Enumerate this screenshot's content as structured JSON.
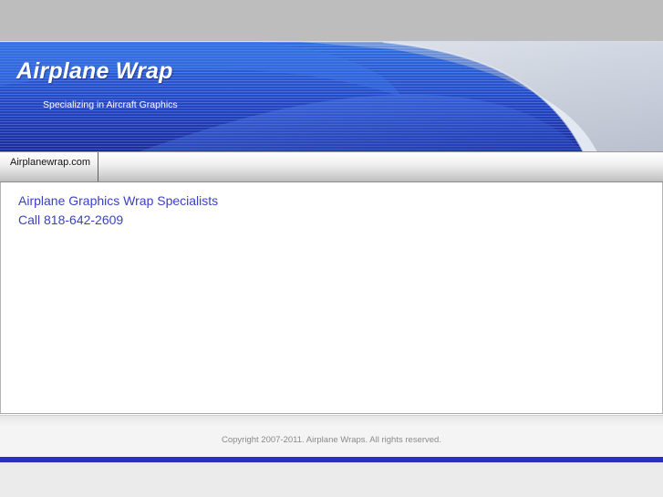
{
  "header": {
    "title": "Airplane Wrap",
    "tagline": "Specializing in Aircraft Graphics"
  },
  "nav": {
    "items": [
      {
        "label": "Airplanewrap.com"
      }
    ]
  },
  "content": {
    "heading": "Airplane Graphics Wrap Specialists",
    "phone": "Call 818-642-2609"
  },
  "footer": {
    "copyright": "Copyright 2007-2011. Airplane Wraps. All rights reserved."
  },
  "colors": {
    "header_blue": "#2a3fbf",
    "link_blue": "#3a40c8",
    "footer_stripe": "#2a2fc0"
  }
}
